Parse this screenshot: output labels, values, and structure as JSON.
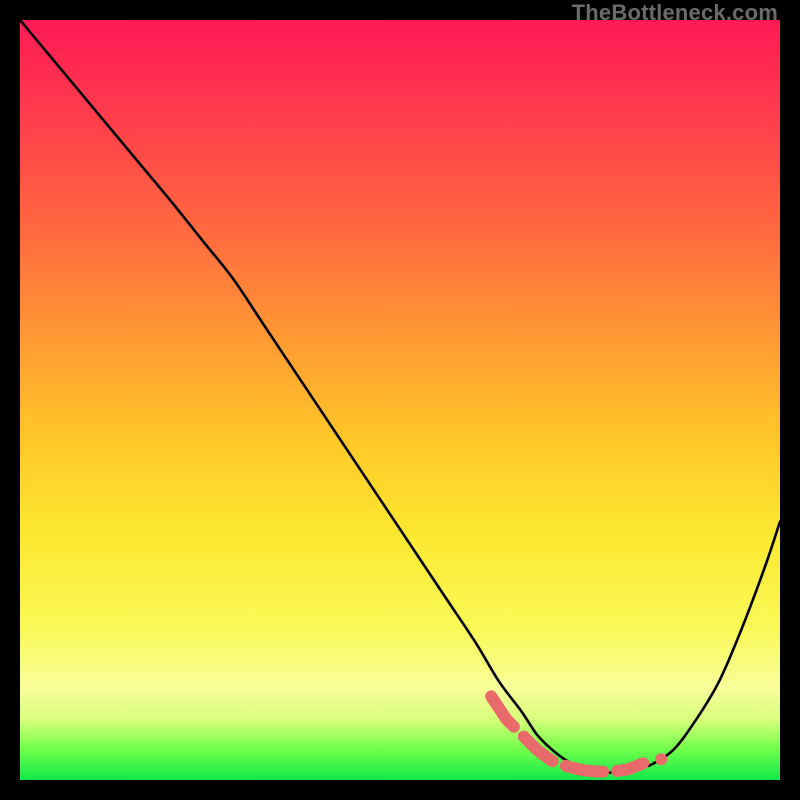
{
  "watermark": "TheBottleneck.com",
  "chart_data": {
    "type": "line",
    "title": "",
    "xlabel": "",
    "ylabel": "",
    "xlim": [
      0,
      100
    ],
    "ylim": [
      0,
      100
    ],
    "grid": false,
    "legend": false,
    "series": [
      {
        "name": "curve",
        "color": "#000000",
        "x": [
          0,
          5,
          10,
          15,
          20,
          24,
          28,
          32,
          36,
          40,
          44,
          48,
          52,
          56,
          60,
          63,
          66,
          68,
          70,
          72,
          74,
          76,
          78,
          80,
          83,
          86,
          89,
          92,
          95,
          98,
          100
        ],
        "y": [
          100,
          94,
          88,
          82,
          76,
          71,
          66,
          60,
          54,
          48,
          42,
          36,
          30,
          24,
          18,
          13,
          9,
          6,
          4,
          2.5,
          1.5,
          1,
          1,
          1.2,
          2,
          4,
          8,
          13,
          20,
          28,
          34
        ]
      }
    ],
    "marker_segment": {
      "name": "highlight-dash",
      "color": "#e86a6a",
      "stroke_width": 12,
      "points_x": [
        62,
        64,
        66,
        68,
        70,
        72,
        74,
        76,
        78,
        80,
        82
      ],
      "points_y": [
        11,
        8,
        6,
        4,
        2.5,
        1.8,
        1.3,
        1.1,
        1.1,
        1.4,
        2.2
      ]
    }
  }
}
